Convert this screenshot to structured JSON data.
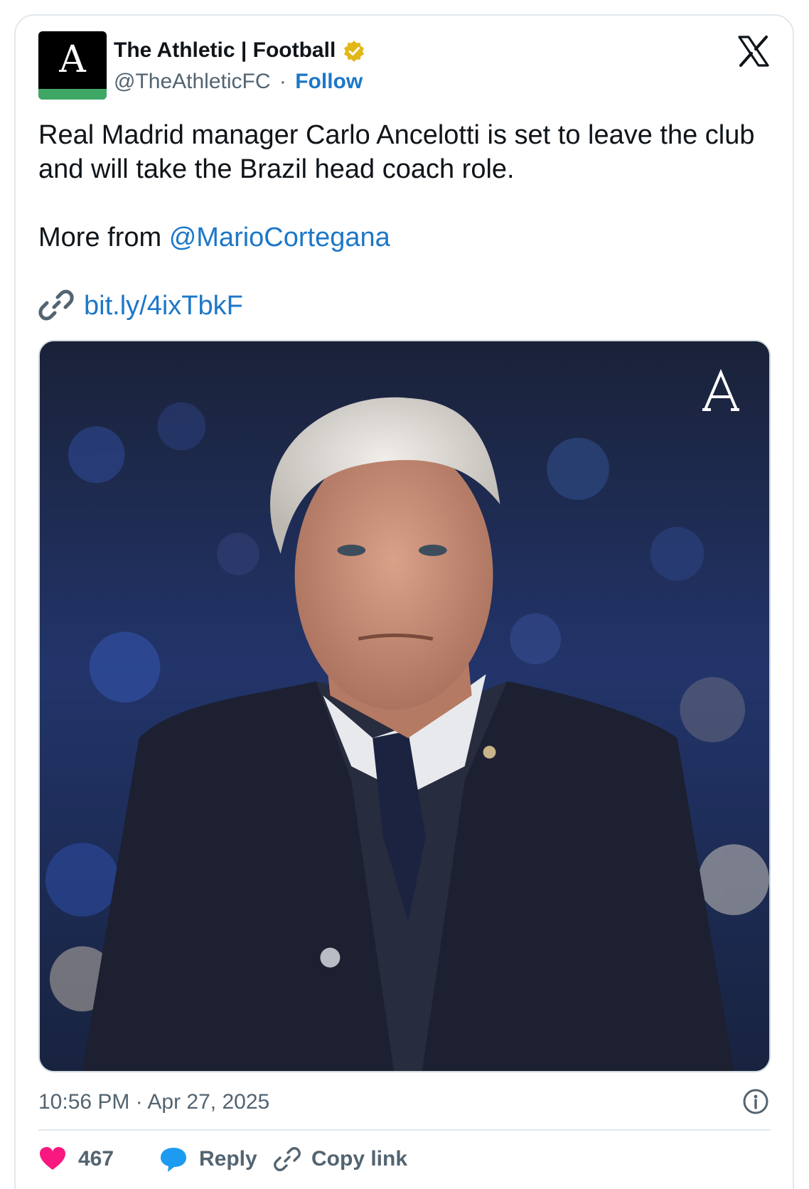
{
  "author": {
    "name": "The Athletic | Football",
    "handle": "@TheAthleticFC",
    "separator": "·",
    "follow_label": "Follow",
    "avatar_letter": "A",
    "verified": true,
    "verified_color": "#e2b719"
  },
  "tweet": {
    "text": "Real Madrid manager Carlo Ancelotti is set to leave the club and will take the Brazil head coach role.",
    "more_prefix": "More from ",
    "mention": "@MarioCortegana",
    "link": "bit.ly/4ixTbkF",
    "image_watermark": "A"
  },
  "meta": {
    "timestamp": "10:56 PM · Apr 27, 2025"
  },
  "actions": {
    "likes_count": "467",
    "reply_label": "Reply",
    "copy_label": "Copy link"
  },
  "icons": {
    "platform": "x-logo-icon",
    "verified": "verified-badge-icon",
    "link": "link-icon",
    "info": "info-icon",
    "like": "heart-icon",
    "reply": "reply-bubble-icon",
    "copy": "copy-link-icon"
  },
  "colors": {
    "link_blue": "#1d77c8",
    "heart": "#f91880",
    "reply": "#1d9bf0",
    "muted": "#536471",
    "avatar_strip": "#3fa765"
  }
}
